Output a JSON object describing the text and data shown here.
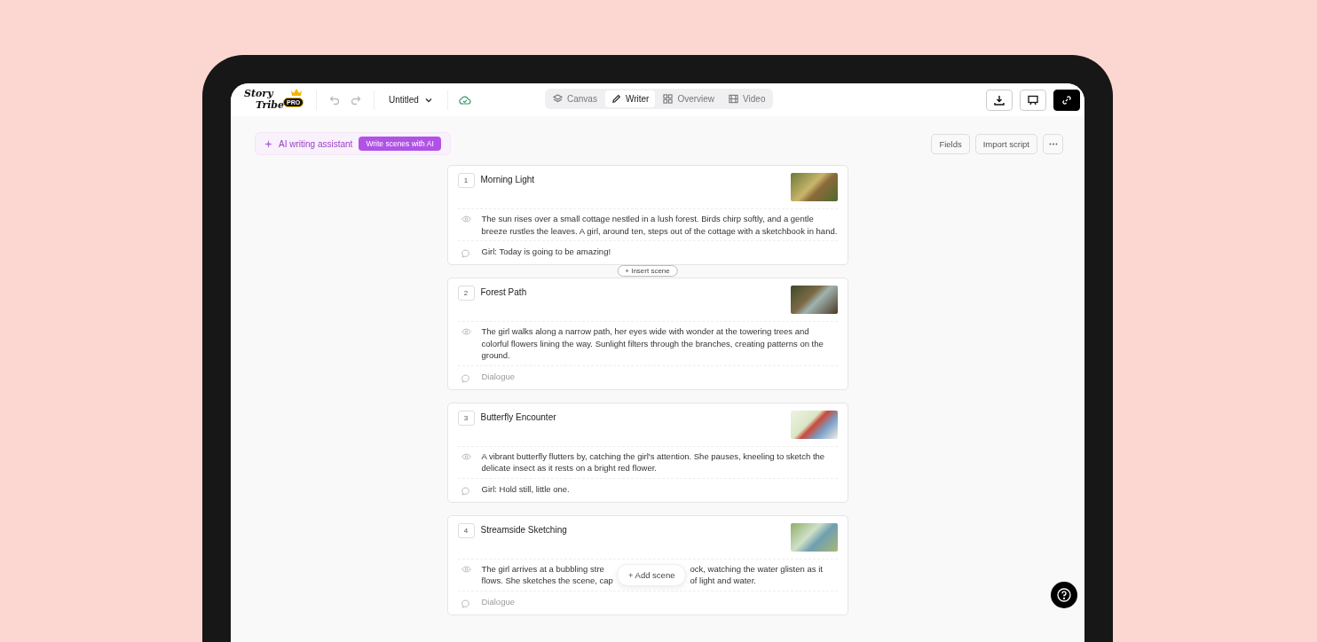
{
  "logo": {
    "line_1": "Story",
    "line_2": "Tribe",
    "badge": "PRO"
  },
  "toolbar": {
    "document_title": "Untitled"
  },
  "view_tabs": [
    {
      "label": "Canvas",
      "selected": false
    },
    {
      "label": "Writer",
      "selected": true
    },
    {
      "label": "Overview",
      "selected": false
    },
    {
      "label": "Video",
      "selected": false
    }
  ],
  "ai_assistant": {
    "label": "AI writing assistant",
    "button": "Write scenes with AI"
  },
  "actions": [
    "Fields",
    "Import script"
  ],
  "scenes": [
    {
      "number": "1",
      "title": "Morning Light",
      "description": "The sun rises over a small cottage nestled in a lush forest. Birds chirp softly, and a gentle breeze rustles the leaves. A girl, around ten, steps out of the cottage with a sketchbook in hand.",
      "dialogue": {
        "value": "Girl: Today is going to be amazing!"
      }
    },
    {
      "number": "2",
      "title": "Forest Path",
      "description": "The girl walks along a narrow path, her eyes wide with wonder at the towering trees and colorful flowers lining the way. Sunlight filters through the branches, creating patterns on the ground.",
      "dialogue": {
        "placeholder": "Dialogue"
      }
    },
    {
      "number": "3",
      "title": "Butterfly Encounter",
      "description": "A vibrant butterfly flutters by, catching the girl's attention. She pauses, kneeling to sketch the delicate insect as it rests on a bright red flower.",
      "dialogue": {
        "value": "Girl: Hold still, little one."
      }
    },
    {
      "number": "4",
      "title": "Streamside Sketching",
      "description_lines": [
        [
          "The girl arrives at a bubbling stre",
          "ock, watching the water glisten as it"
        ],
        [
          "flows. She sketches the scene, cap",
          "of light and water."
        ]
      ],
      "dialogue": {
        "placeholder": "Dialogue"
      }
    }
  ],
  "insert_scene": "+ Insert scene",
  "add_scene": "+ Add scene"
}
